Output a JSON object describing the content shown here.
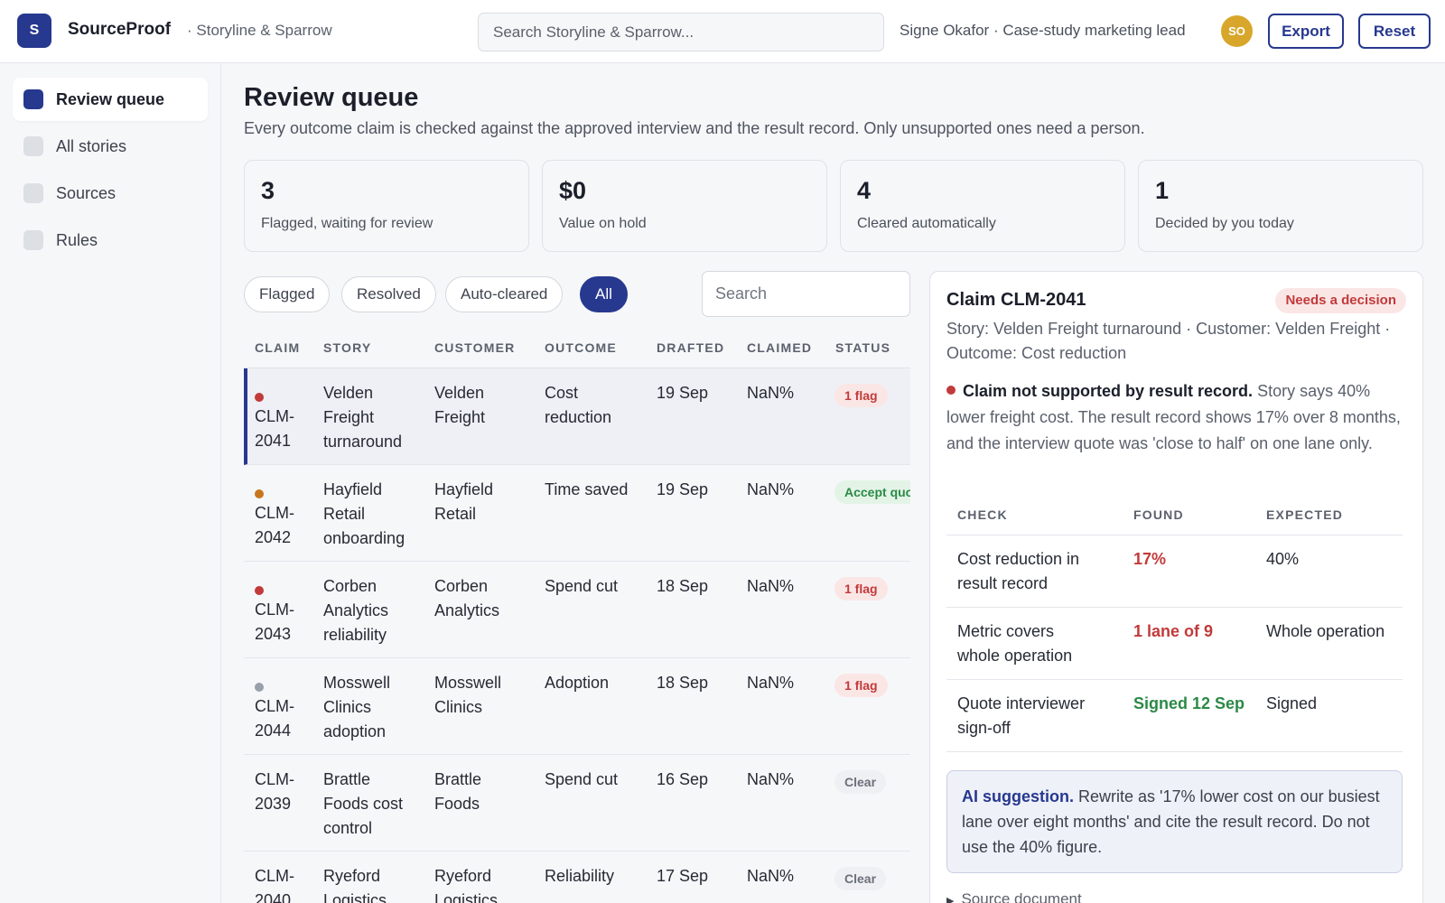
{
  "app": {
    "logo_letter": "S",
    "name": "SourceProof",
    "workspace": "· Storyline & Sparrow",
    "search_placeholder": "Search Storyline & Sparrow...",
    "user": "Signe Okafor · Case-study marketing lead",
    "avatar_initials": "SO",
    "export_label": "Export",
    "reset_label": "Reset"
  },
  "sidebar": {
    "items": [
      {
        "label": "Review queue",
        "active": true
      },
      {
        "label": "All stories",
        "active": false
      },
      {
        "label": "Sources",
        "active": false
      },
      {
        "label": "Rules",
        "active": false
      }
    ]
  },
  "page": {
    "title": "Review queue",
    "subtitle": "Every outcome claim is checked against the approved interview and the result record. Only unsupported ones need a person."
  },
  "stats": [
    {
      "value": "3",
      "label": "Flagged, waiting for review"
    },
    {
      "value": "$0",
      "label": "Value on hold"
    },
    {
      "value": "4",
      "label": "Cleared automatically"
    },
    {
      "value": "1",
      "label": "Decided by you today"
    }
  ],
  "filters": {
    "chips": [
      "Flagged",
      "Resolved",
      "Auto-cleared",
      "All"
    ],
    "active": "All",
    "search_placeholder": "Search"
  },
  "table": {
    "columns": [
      "CLAIM",
      "STORY",
      "CUSTOMER",
      "OUTCOME",
      "DRAFTED",
      "CLAIMED",
      "STATUS"
    ],
    "rows": [
      {
        "dot": "#c23a3a",
        "claim_1": "CLM-",
        "claim_2": "2041",
        "story": [
          "Velden",
          "Freight",
          "turnaround"
        ],
        "customer": [
          "Velden",
          "Freight"
        ],
        "outcome": [
          "Cost",
          "reduction"
        ],
        "drafted": "19 Sep",
        "claimed": "NaN%",
        "status": "1 flag",
        "status_kind": "flag",
        "selected": true
      },
      {
        "dot": "#c8761d",
        "claim_1": "CLM-",
        "claim_2": "2042",
        "story": [
          "Hayfield",
          "Retail",
          "onboarding"
        ],
        "customer": [
          "Hayfield",
          "Retail"
        ],
        "outcome": [
          "Time saved"
        ],
        "drafted": "19 Sep",
        "claimed": "NaN%",
        "status": "Accept quote",
        "status_kind": "accept",
        "selected": false
      },
      {
        "dot": "#c23a3a",
        "claim_1": "CLM-",
        "claim_2": "2043",
        "story": [
          "Corben",
          "Analytics",
          "reliability"
        ],
        "customer": [
          "Corben",
          "Analytics"
        ],
        "outcome": [
          "Spend cut"
        ],
        "drafted": "18 Sep",
        "claimed": "NaN%",
        "status": "1 flag",
        "status_kind": "flag",
        "selected": false
      },
      {
        "dot": "#9aa0ab",
        "claim_1": "CLM-",
        "claim_2": "2044",
        "story": [
          "Mosswell",
          "Clinics",
          "adoption"
        ],
        "customer": [
          "Mosswell",
          "Clinics"
        ],
        "outcome": [
          "Adoption"
        ],
        "drafted": "18 Sep",
        "claimed": "NaN%",
        "status": "1 flag",
        "status_kind": "flag",
        "selected": false
      },
      {
        "dot": "",
        "claim_1": "CLM-",
        "claim_2": "2039",
        "story": [
          "Brattle",
          "Foods cost",
          "control"
        ],
        "customer": [
          "Brattle",
          "Foods"
        ],
        "outcome": [
          "Spend cut"
        ],
        "drafted": "16 Sep",
        "claimed": "NaN%",
        "status": "Clear",
        "status_kind": "clear",
        "selected": false
      },
      {
        "dot": "",
        "claim_1": "CLM-",
        "claim_2": "2040",
        "story": [
          "Ryeford",
          "Logistics"
        ],
        "customer": [
          "Ryeford",
          "Logistics"
        ],
        "outcome": [
          "Reliability"
        ],
        "drafted": "17 Sep",
        "claimed": "NaN%",
        "status": "Clear",
        "status_kind": "clear",
        "selected": false
      }
    ]
  },
  "detail": {
    "title": "Claim CLM-2041",
    "badge": "Needs a decision",
    "meta": "Story: Velden Freight turnaround · Customer: Velden Freight · Outcome: Cost reduction",
    "alert_strong": "Claim not supported by result record.",
    "alert_text": "Story says 40% lower freight cost. The result record shows 17% over 8 months, and the interview quote was 'close to half' on one lane only.",
    "check_columns": [
      "CHECK",
      "FOUND",
      "EXPECTED"
    ],
    "checks": [
      {
        "check": [
          "Cost reduction in",
          "result record"
        ],
        "found": "17%",
        "found_kind": "bad",
        "expected": "40%"
      },
      {
        "check": [
          "Metric covers",
          "whole operation"
        ],
        "found": "1 lane of 9",
        "found_kind": "bad",
        "expected": "Whole operation"
      },
      {
        "check": [
          "Quote interviewer",
          "sign-off"
        ],
        "found": "Signed 12 Sep",
        "found_kind": "good",
        "expected": "Signed"
      }
    ],
    "ai_strong": "AI suggestion.",
    "ai_text": "Rewrite as '17% lower cost on our busiest lane over eight months' and cite the result record. Do not use the 40% figure.",
    "source_doc": "Source document"
  },
  "colors": {
    "accent": "#27388f",
    "flag": "#c23a3a",
    "ok": "#2b8a46",
    "avatar": "#d8a62b"
  }
}
